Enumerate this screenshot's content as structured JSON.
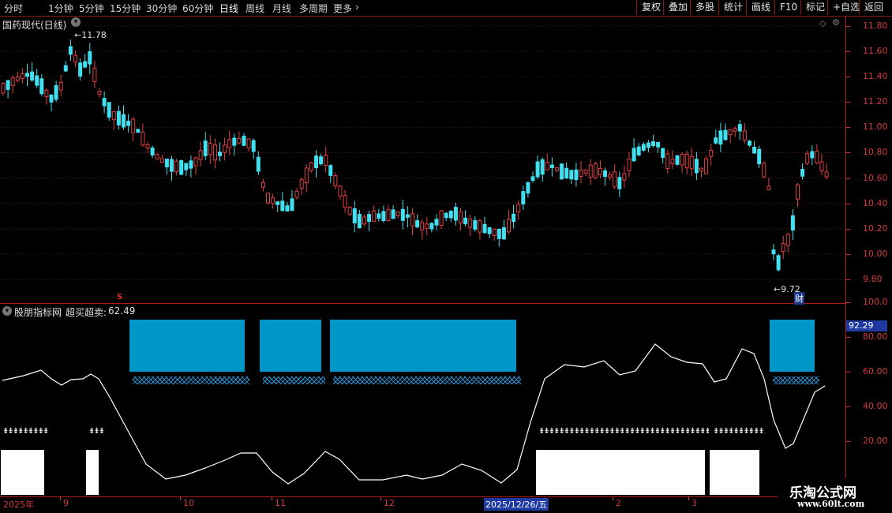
{
  "toolbar": {
    "periods": [
      "分时",
      "1分钟",
      "5分钟",
      "15分钟",
      "30分钟",
      "60分钟",
      "日线",
      "周线",
      "月线",
      "多周期",
      "更多"
    ],
    "active_period": "日线",
    "buttons": [
      "复权",
      "叠加",
      "多股",
      "统计",
      "画线",
      "F10",
      "标记",
      "+自选",
      "返回"
    ]
  },
  "main_chart": {
    "title": "国药现代(日线)",
    "high_marker": "11.78",
    "low_marker": "9.72",
    "finance_mark": "财",
    "s_mark": "S",
    "colors": {
      "up": "#e04040",
      "down": "#40e0f0",
      "grid": "#6a1212",
      "axis": "#d23c3c"
    }
  },
  "indicator": {
    "name": "股朋指标网",
    "series_label": "超买超卖:",
    "series_value": "62.49",
    "current_badge": "92.29",
    "colors": {
      "line": "#ffffff",
      "block": "#0096c8",
      "signal": "#ffffff"
    }
  },
  "watermark": {
    "name": "乐淘公式网",
    "url": "www.60lt.com"
  },
  "chart_data": [
    {
      "type": "candlestick",
      "y_axis": [
        "11.80",
        "11.60",
        "11.40",
        "11.20",
        "11.00",
        "10.80",
        "10.60",
        "10.40",
        "10.20",
        "10.00",
        "9.80"
      ],
      "ylim": [
        9.72,
        11.88
      ]
    },
    {
      "type": "line",
      "y_axis": [
        "100.0",
        "80.00",
        "60.00",
        "40.00",
        "20.00"
      ],
      "ylim": [
        0,
        100
      ]
    }
  ],
  "x_axis": {
    "dates": [
      "2025年",
      "9",
      "10",
      "11",
      "12",
      "2025/12/26/五",
      "2",
      "3"
    ]
  }
}
